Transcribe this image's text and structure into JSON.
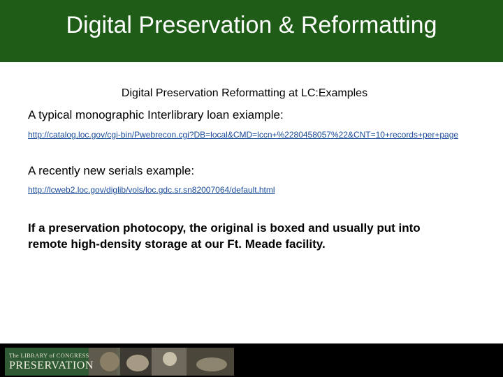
{
  "header": {
    "title": "Digital Preservation & Reformatting"
  },
  "main": {
    "subtitle": "Digital Preservation Reformatting at LC:Examples",
    "example1": {
      "label": "A typical monographic Interlibrary loan exiample:",
      "link": "http://catalog.loc.gov/cgi-bin/Pwebrecon.cgi?DB=local&CMD=lccn+%2280458057%22&CNT=10+records+per+page"
    },
    "example2": {
      "label": "A recently new serials example:",
      "link": "http://lcweb2.loc.gov/diglib/vols/loc.gdc.sr.sn82007064/default.html"
    },
    "note": "If a preservation photocopy, the original is boxed and usually put into remote high-density storage at our Ft. Meade facility."
  },
  "footer": {
    "logo_line1": "The LIBRARY of CONGRESS",
    "logo_line2": "PRESERVATION"
  }
}
